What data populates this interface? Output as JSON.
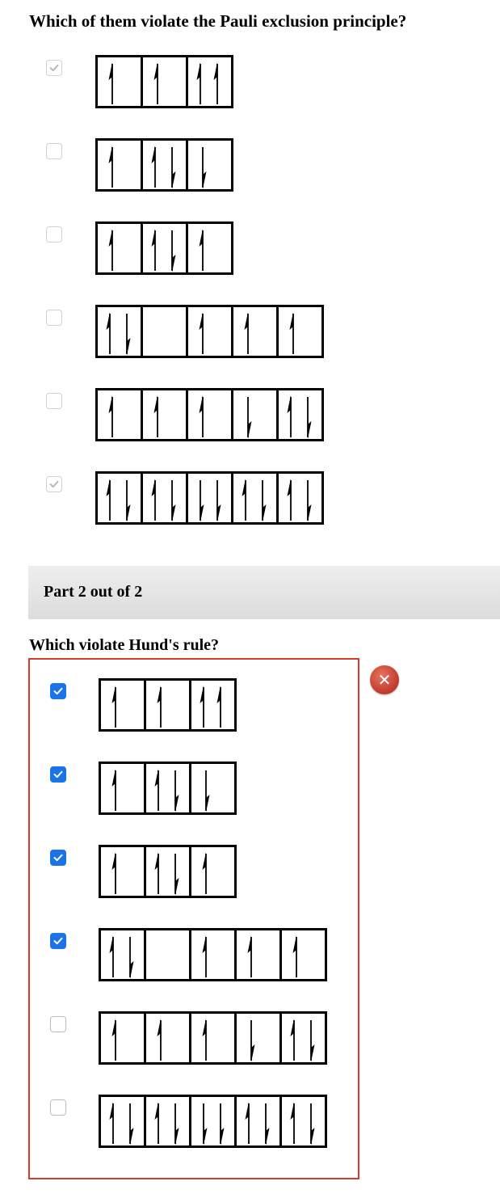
{
  "part1": {
    "question": "Which of them violate the Pauli exclusion principle?",
    "options": [
      {
        "state": "disabled-checked",
        "orbitals": [
          [
            "up"
          ],
          [
            "up"
          ],
          [
            "up",
            "up"
          ]
        ]
      },
      {
        "state": "disabled-unchecked",
        "orbitals": [
          [
            "up"
          ],
          [
            "up",
            "down"
          ],
          [
            "down"
          ]
        ]
      },
      {
        "state": "disabled-unchecked",
        "orbitals": [
          [
            "up"
          ],
          [
            "up",
            "down"
          ],
          [
            "up"
          ]
        ]
      },
      {
        "state": "disabled-unchecked",
        "orbitals": [
          [
            "up",
            "down"
          ],
          [],
          [
            "up"
          ],
          [
            "up"
          ],
          [
            "up"
          ]
        ]
      },
      {
        "state": "disabled-unchecked",
        "orbitals": [
          [
            "up"
          ],
          [
            "up"
          ],
          [
            "up"
          ],
          [
            "down"
          ],
          [
            "up",
            "down"
          ]
        ]
      },
      {
        "state": "disabled-checked",
        "orbitals": [
          [
            "up",
            "down"
          ],
          [
            "up",
            "down"
          ],
          [
            "down",
            "down"
          ],
          [
            "up",
            "down"
          ],
          [
            "up",
            "down"
          ]
        ]
      }
    ]
  },
  "part2": {
    "header": "Part 2 out of 2",
    "question": "Which violate Hund's rule?",
    "status_icon": "error-x-icon",
    "status_glyph": "✕",
    "status_color": "#c0392b",
    "options": [
      {
        "state": "checked",
        "orbitals": [
          [
            "up"
          ],
          [
            "up"
          ],
          [
            "up",
            "up"
          ]
        ]
      },
      {
        "state": "checked",
        "orbitals": [
          [
            "up"
          ],
          [
            "up",
            "down"
          ],
          [
            "down"
          ]
        ]
      },
      {
        "state": "checked",
        "orbitals": [
          [
            "up"
          ],
          [
            "up",
            "down"
          ],
          [
            "up"
          ]
        ]
      },
      {
        "state": "checked",
        "orbitals": [
          [
            "up",
            "down"
          ],
          [],
          [
            "up"
          ],
          [
            "up"
          ],
          [
            "up"
          ]
        ]
      },
      {
        "state": "unchecked",
        "orbitals": [
          [
            "up"
          ],
          [
            "up"
          ],
          [
            "up"
          ],
          [
            "down"
          ],
          [
            "up",
            "down"
          ]
        ]
      },
      {
        "state": "unchecked",
        "orbitals": [
          [
            "up",
            "down"
          ],
          [
            "up",
            "down"
          ],
          [
            "down",
            "down"
          ],
          [
            "up",
            "down"
          ],
          [
            "up",
            "down"
          ]
        ]
      }
    ]
  }
}
